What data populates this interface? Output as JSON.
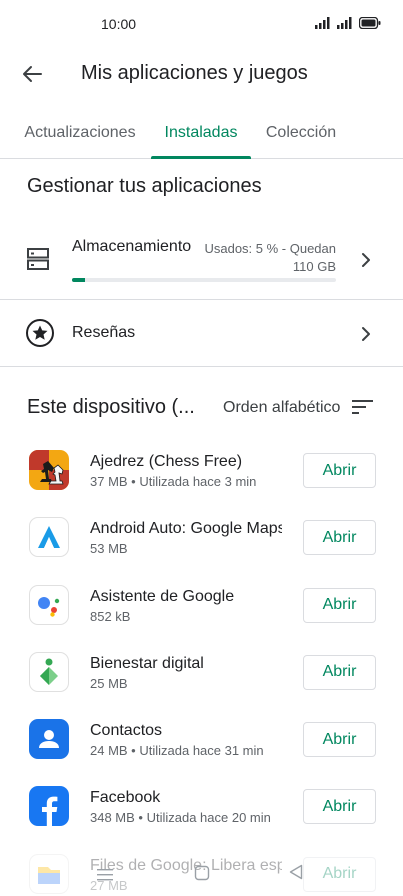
{
  "status_bar": {
    "time": "10:00"
  },
  "header": {
    "title": "Mis aplicaciones y juegos"
  },
  "tabs": [
    {
      "label": "Actualizaciones",
      "active": false
    },
    {
      "label": "Instaladas",
      "active": true
    },
    {
      "label": "Colección",
      "active": false
    }
  ],
  "manage": {
    "title": "Gestionar tus aplicaciones",
    "storage": {
      "label": "Almacenamiento",
      "usage_line1": "Usados: 5 % - Quedan",
      "usage_line2": "110 GB",
      "used_fraction": 0.05
    },
    "reviews": {
      "label": "Reseñas"
    }
  },
  "device": {
    "title": "Este dispositivo (...",
    "sort_label": "Orden alfabético"
  },
  "apps": [
    {
      "name": "Ajedrez (Chess Free)",
      "meta": "37 MB • Utilizada hace 3 min",
      "button": "Abrir",
      "icon": "chess-icon"
    },
    {
      "name": "Android Auto: Google Maps,",
      "meta": "53 MB",
      "button": "Abrir",
      "icon": "android-auto-icon"
    },
    {
      "name": "Asistente de Google",
      "meta": "852 kB",
      "button": "Abrir",
      "icon": "google-assistant-icon"
    },
    {
      "name": "Bienestar digital",
      "meta": "25 MB",
      "button": "Abrir",
      "icon": "digital-wellbeing-icon"
    },
    {
      "name": "Contactos",
      "meta": "24 MB • Utilizada hace 31 min",
      "button": "Abrir",
      "icon": "contacts-icon"
    },
    {
      "name": "Facebook",
      "meta": "348 MB • Utilizada hace 20 min",
      "button": "Abrir",
      "icon": "facebook-icon"
    },
    {
      "name": "Files de Google: Libera esp",
      "meta": "27 MB",
      "button": "Abrir",
      "icon": "files-icon"
    }
  ],
  "colors": {
    "accent": "#01875f",
    "divider": "#dadce0",
    "text_primary": "#202124",
    "text_secondary": "#5f6368"
  }
}
